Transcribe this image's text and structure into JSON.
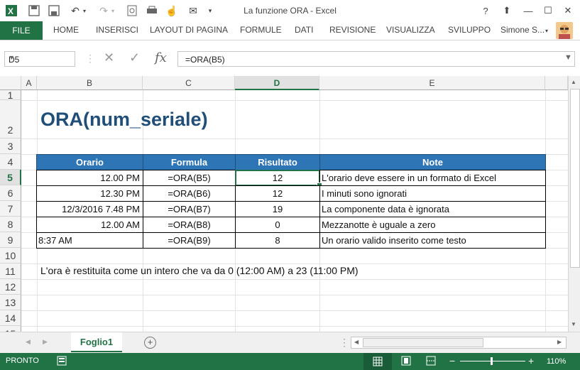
{
  "window": {
    "title": "La funzione ORA - Excel"
  },
  "ribbon": {
    "file_label": "FILE",
    "tabs": [
      "HOME",
      "INSERISCI",
      "LAYOUT DI PAGINA",
      "FORMULE",
      "DATI",
      "REVISIONE",
      "VISUALIZZA",
      "SVILUPPO"
    ],
    "user": "Simone S..."
  },
  "formula_bar": {
    "name_box": "D5",
    "formula": "=ORA(B5)"
  },
  "columns": [
    "A",
    "B",
    "C",
    "D",
    "E"
  ],
  "rows": [
    "1",
    "2",
    "3",
    "4",
    "5",
    "6",
    "7",
    "8",
    "9",
    "10",
    "11",
    "12",
    "13",
    "14",
    "15"
  ],
  "sheet": {
    "title": "ORA(num_seriale)",
    "table": {
      "headers": [
        "Orario",
        "Formula",
        "Risultato",
        "Note"
      ],
      "rows": [
        [
          "12.00 PM",
          "=ORA(B5)",
          "12",
          "L'orario deve essere in un formato di Excel"
        ],
        [
          "12.30 PM",
          "=ORA(B6)",
          "12",
          "I minuti sono ignorati"
        ],
        [
          "12/3/2016 7.48 PM",
          "=ORA(B7)",
          "19",
          "La componente data è ignorata"
        ],
        [
          "12.00 AM",
          "=ORA(B8)",
          "0",
          "Mezzanotte è uguale a zero"
        ],
        [
          "8:37 AM",
          "=ORA(B9)",
          "8",
          "Un orario valido inserito come testo"
        ]
      ]
    },
    "note": "L'ora è restituita come un intero che va da 0 (12:00 AM) a 23 (11:00 PM)"
  },
  "tabs_bar": {
    "sheet_name": "Foglio1"
  },
  "status": {
    "ready": "PRONTO",
    "zoom": "110%"
  },
  "colors": {
    "accent": "#217346",
    "header_fill": "#2e75b6",
    "title_color": "#1f4e79"
  }
}
